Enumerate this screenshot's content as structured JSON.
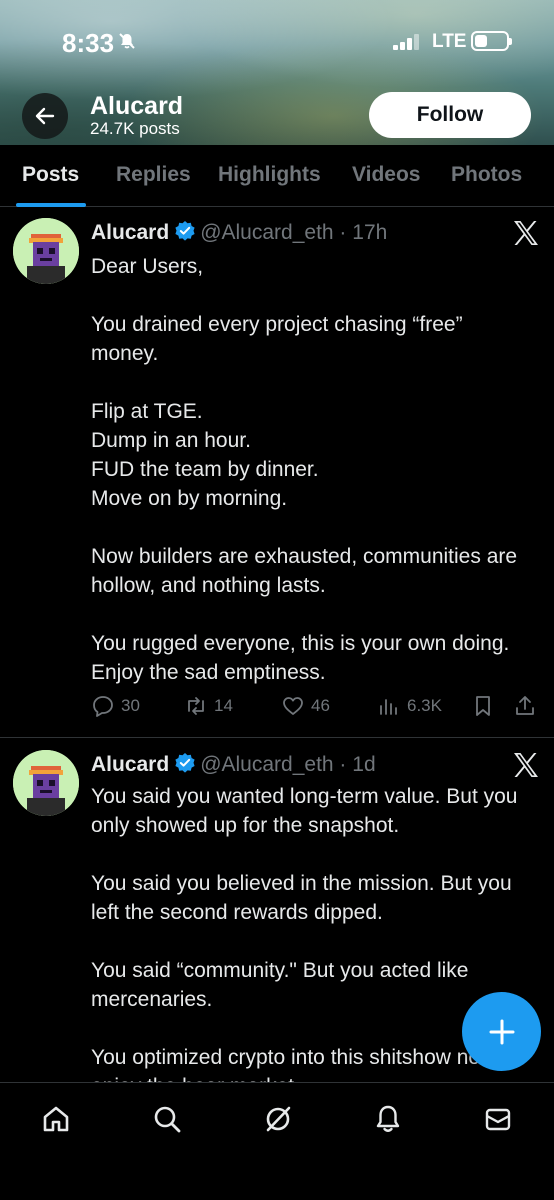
{
  "status_bar": {
    "time": "8:33",
    "network": "LTE"
  },
  "profile": {
    "name": "Alucard",
    "posts_count": "24.7K posts",
    "follow_label": "Follow"
  },
  "tabs": [
    {
      "label": "Posts",
      "active": true
    },
    {
      "label": "Replies",
      "active": false
    },
    {
      "label": "Highlights",
      "active": false
    },
    {
      "label": "Videos",
      "active": false
    },
    {
      "label": "Photos",
      "active": false
    }
  ],
  "posts": [
    {
      "name": "Alucard",
      "handle": "@Alucard_eth",
      "time": "17h",
      "paragraphs": [
        "Dear Users,",
        "You drained every project chasing “free” money.",
        "Flip at TGE.\nDump in an hour.\nFUD the team by dinner.\nMove on by morning.",
        "Now builders are exhausted, communities are hollow, and nothing lasts.",
        "You rugged everyone, this is your own doing. Enjoy the sad emptiness."
      ],
      "replies": "30",
      "reposts": "14",
      "likes": "46",
      "views": "6.3K"
    },
    {
      "name": "Alucard",
      "handle": "@Alucard_eth",
      "time": "1d",
      "paragraphs": [
        "You said you wanted long-term value. But you only showed up for the snapshot.",
        "You said you believed in the mission. But you left the second rewards dipped.",
        "You said “community.\" But you acted like mercenaries.",
        "You optimized crypto into this shitshow now enjoy the bear market"
      ]
    }
  ],
  "colors": {
    "accent": "#1d9bf0",
    "background": "#000000",
    "text": "#e7e9ea",
    "muted": "#71767b"
  }
}
